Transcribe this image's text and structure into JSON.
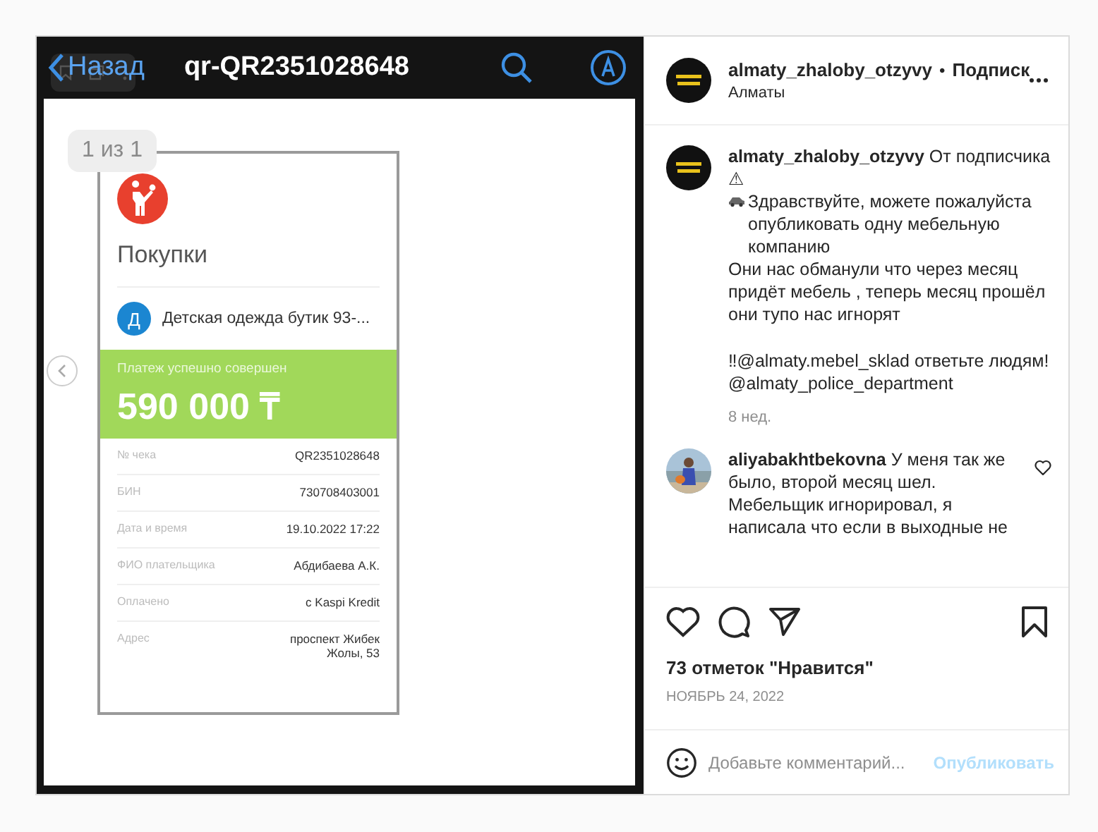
{
  "photo": {
    "topbar": {
      "back": "Назад",
      "title": "qr-QR2351028648"
    },
    "page_counter": "1 из 1",
    "receipt": {
      "category": "Покупки",
      "merchant_initial": "Д",
      "merchant": "Детская одежда бутик 93-...",
      "status": "Платеж успешно совершен",
      "amount": "590 000 ₸",
      "details": [
        {
          "label": "№ чека",
          "value": "QR2351028648"
        },
        {
          "label": "БИН",
          "value": "730708403001"
        },
        {
          "label": "Дата и время",
          "value": "19.10.2022 17:22"
        },
        {
          "label": "ФИО плательщика",
          "value": "Абдибаева А.К."
        },
        {
          "label": "Оплачено",
          "value": "с Kaspi Kredit"
        },
        {
          "label": "Адрес",
          "value": "проспект Жибек Жолы, 53"
        }
      ]
    }
  },
  "post": {
    "header": {
      "username": "almaty_zhaloby_otzyvy",
      "separator": "•",
      "follow": "Подписк",
      "location": "Алматы"
    },
    "caption": [
      {
        "kind": "plain",
        "text": "**almaty_zhaloby_otzyvy** От подписчика ⚠"
      },
      {
        "kind": "with_emoji",
        "text": "Здравствуйте, можете пожалуйста опубликовать одну мебельную компанию"
      },
      {
        "kind": "plain",
        "text": "Они нас обманули что через месяц придёт мебель , теперь месяц прошёл они тупо нас игнорят"
      },
      {
        "kind": "spacer"
      },
      {
        "kind": "plain",
        "text": "‼@almaty.mebel_sklad ответьте людям!"
      },
      {
        "kind": "plain",
        "text": "@almaty_police_department"
      }
    ],
    "caption_age": "8 нед.",
    "comments": [
      {
        "username": "aliyabakhtbekovna",
        "text": "У меня так же было, второй месяц шел. Мебельщик игнорировал, я написала что если в выходные не",
        "liked": false
      }
    ],
    "likes": "73 отметок \"Нравится\"",
    "date": "НОЯБРЬ 24, 2022",
    "comment_field": {
      "placeholder": "Добавьте комментарий...",
      "submit": "Опубликовать"
    }
  }
}
